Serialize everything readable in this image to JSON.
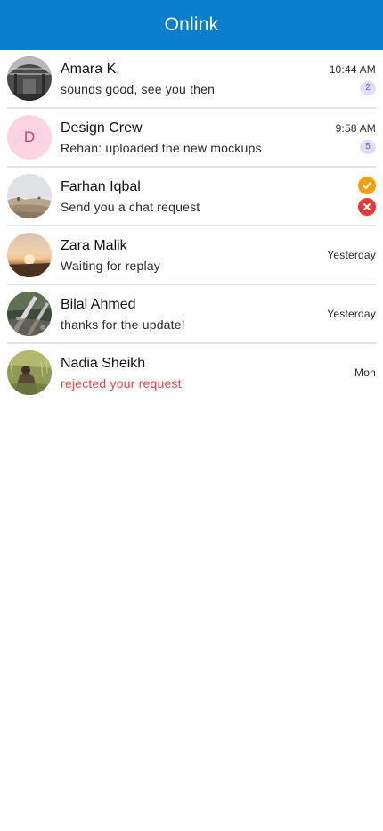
{
  "app": {
    "title": "Onlink",
    "accent": "#0a7fce"
  },
  "chats": [
    {
      "name": "Amara K.",
      "preview": "sounds good, see you then",
      "time": "10:44 AM",
      "unread": "2",
      "avatar": "photo-industrial-hall"
    },
    {
      "name": "Design Crew",
      "preview": "Rehan: uploaded the new mockups",
      "time": "9:58 AM",
      "unread": "5",
      "avatar_letter": "D"
    },
    {
      "name": "Farhan Iqbal",
      "preview": "Send you a chat request",
      "avatar": "photo-misty-field",
      "actions": {
        "accept_icon": "check-icon",
        "reject_icon": "close-icon",
        "accept_color": "#f59e0b",
        "reject_color": "#e53935"
      }
    },
    {
      "name": "Zara Malik",
      "preview": "Waiting for replay",
      "time": "Yesterday",
      "avatar": "photo-sunset-field"
    },
    {
      "name": "Bilal Ahmed",
      "preview": "thanks for the update!",
      "time": "Yesterday",
      "avatar": "photo-broken-railway"
    },
    {
      "name": "Nadia Sheikh",
      "preview": "rejected your request",
      "preview_color": "#ef4444",
      "time": "Mon",
      "avatar": "photo-grass-field"
    }
  ]
}
